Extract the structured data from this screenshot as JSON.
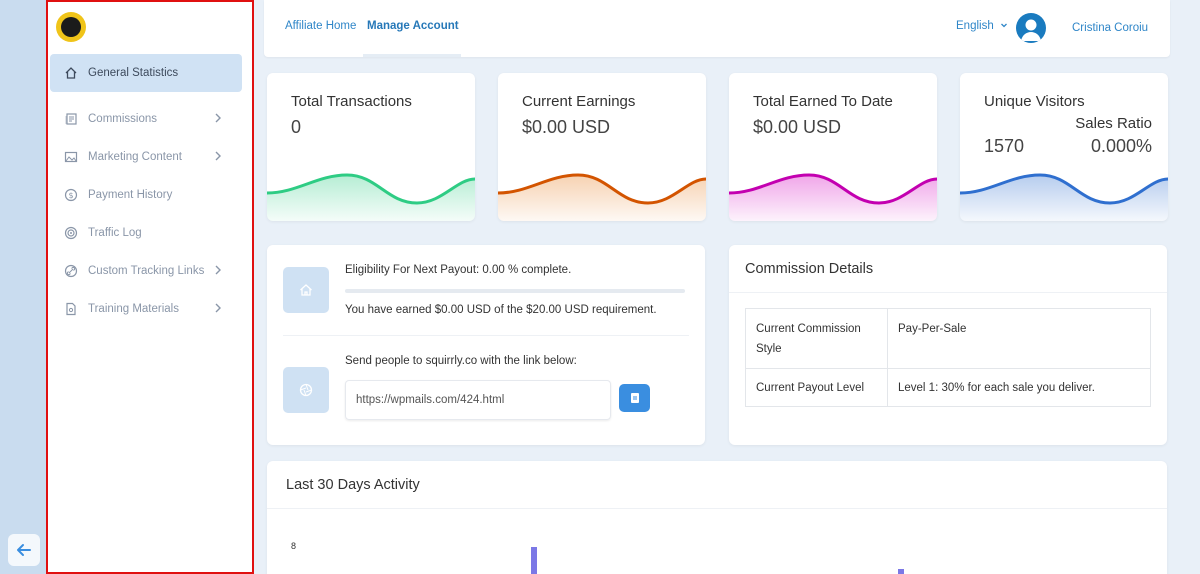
{
  "sidebar": {
    "items": [
      {
        "label": "General Statistics",
        "icon": "home-icon",
        "active": true,
        "chevron": false
      },
      {
        "label": "Commissions",
        "icon": "commissions-icon",
        "active": false,
        "chevron": true
      },
      {
        "label": "Marketing Content",
        "icon": "image-icon",
        "active": false,
        "chevron": true
      },
      {
        "label": "Payment History",
        "icon": "dollar-icon",
        "active": false,
        "chevron": false
      },
      {
        "label": "Traffic Log",
        "icon": "target-icon",
        "active": false,
        "chevron": false
      },
      {
        "label": "Custom Tracking Links",
        "icon": "link-icon",
        "active": false,
        "chevron": true
      },
      {
        "label": "Training Materials",
        "icon": "document-icon",
        "active": false,
        "chevron": true
      }
    ]
  },
  "header": {
    "tabs": [
      {
        "label": "Affiliate Home",
        "active": false
      },
      {
        "label": "Manage Account",
        "active": true
      }
    ],
    "language": "English",
    "username": "Cristina Coroiu"
  },
  "stats": [
    {
      "title": "Total Transactions",
      "value": "0",
      "color": "#2ecc84"
    },
    {
      "title": "Current Earnings",
      "value": "$0.00 USD",
      "color": "#d35400"
    },
    {
      "title": "Total Earned To Date",
      "value": "$0.00 USD",
      "color": "#c300b0"
    },
    {
      "title": "Unique Visitors",
      "value": "1570",
      "sub_title": "Sales Ratio",
      "sub_value": "0.000%",
      "color": "#2f6fcf"
    }
  ],
  "payout": {
    "eligibility": "Eligibility For Next Payout: 0.00 % complete.",
    "progress_percent": 0,
    "earned_text": "You have earned $0.00 USD of the $20.00 USD requirement.",
    "send_text": "Send people to squirrly.co with the link below:",
    "link": "https://wpmails.com/424.html"
  },
  "commission": {
    "title": "Commission Details",
    "rows": [
      {
        "label": "Current Commission Style",
        "value": "Pay-Per-Sale"
      },
      {
        "label": "Current Payout Level",
        "value": "Level 1: 30% for each sale you deliver."
      }
    ]
  },
  "activity": {
    "title": "Last 30 Days Activity",
    "y_tick": "8"
  }
}
